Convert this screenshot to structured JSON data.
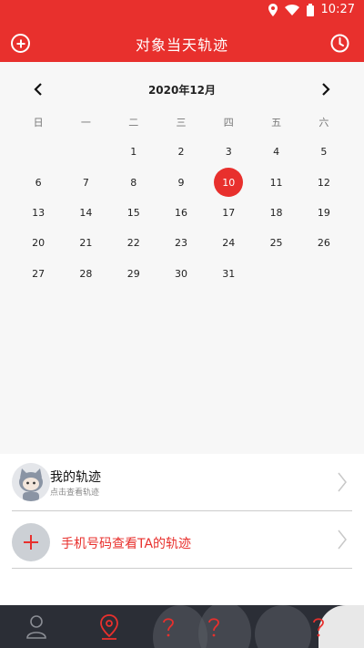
{
  "status_bar": {
    "time": "10:27"
  },
  "app_bar": {
    "title": "对象当天轨迹"
  },
  "calendar": {
    "month_title": "2020年12月",
    "weekdays": [
      "日",
      "一",
      "二",
      "三",
      "四",
      "五",
      "六"
    ],
    "leading_blanks": 2,
    "days_in_month": 31,
    "selected_day": 10
  },
  "list": {
    "my_track": {
      "title": "我的轨迹",
      "subtitle": "点击查看轨迹"
    },
    "phone_track": {
      "label": "手机号码查看TA的轨迹"
    }
  },
  "tabs": [
    {
      "icon": "person-icon"
    },
    {
      "icon": "location-pin-icon",
      "active": true
    },
    {
      "icon": "question-icon"
    },
    {
      "icon": "question-icon"
    },
    {
      "icon": "question-icon"
    }
  ],
  "colors": {
    "accent": "#e8302d",
    "tab_bar": "#2b2e36"
  }
}
